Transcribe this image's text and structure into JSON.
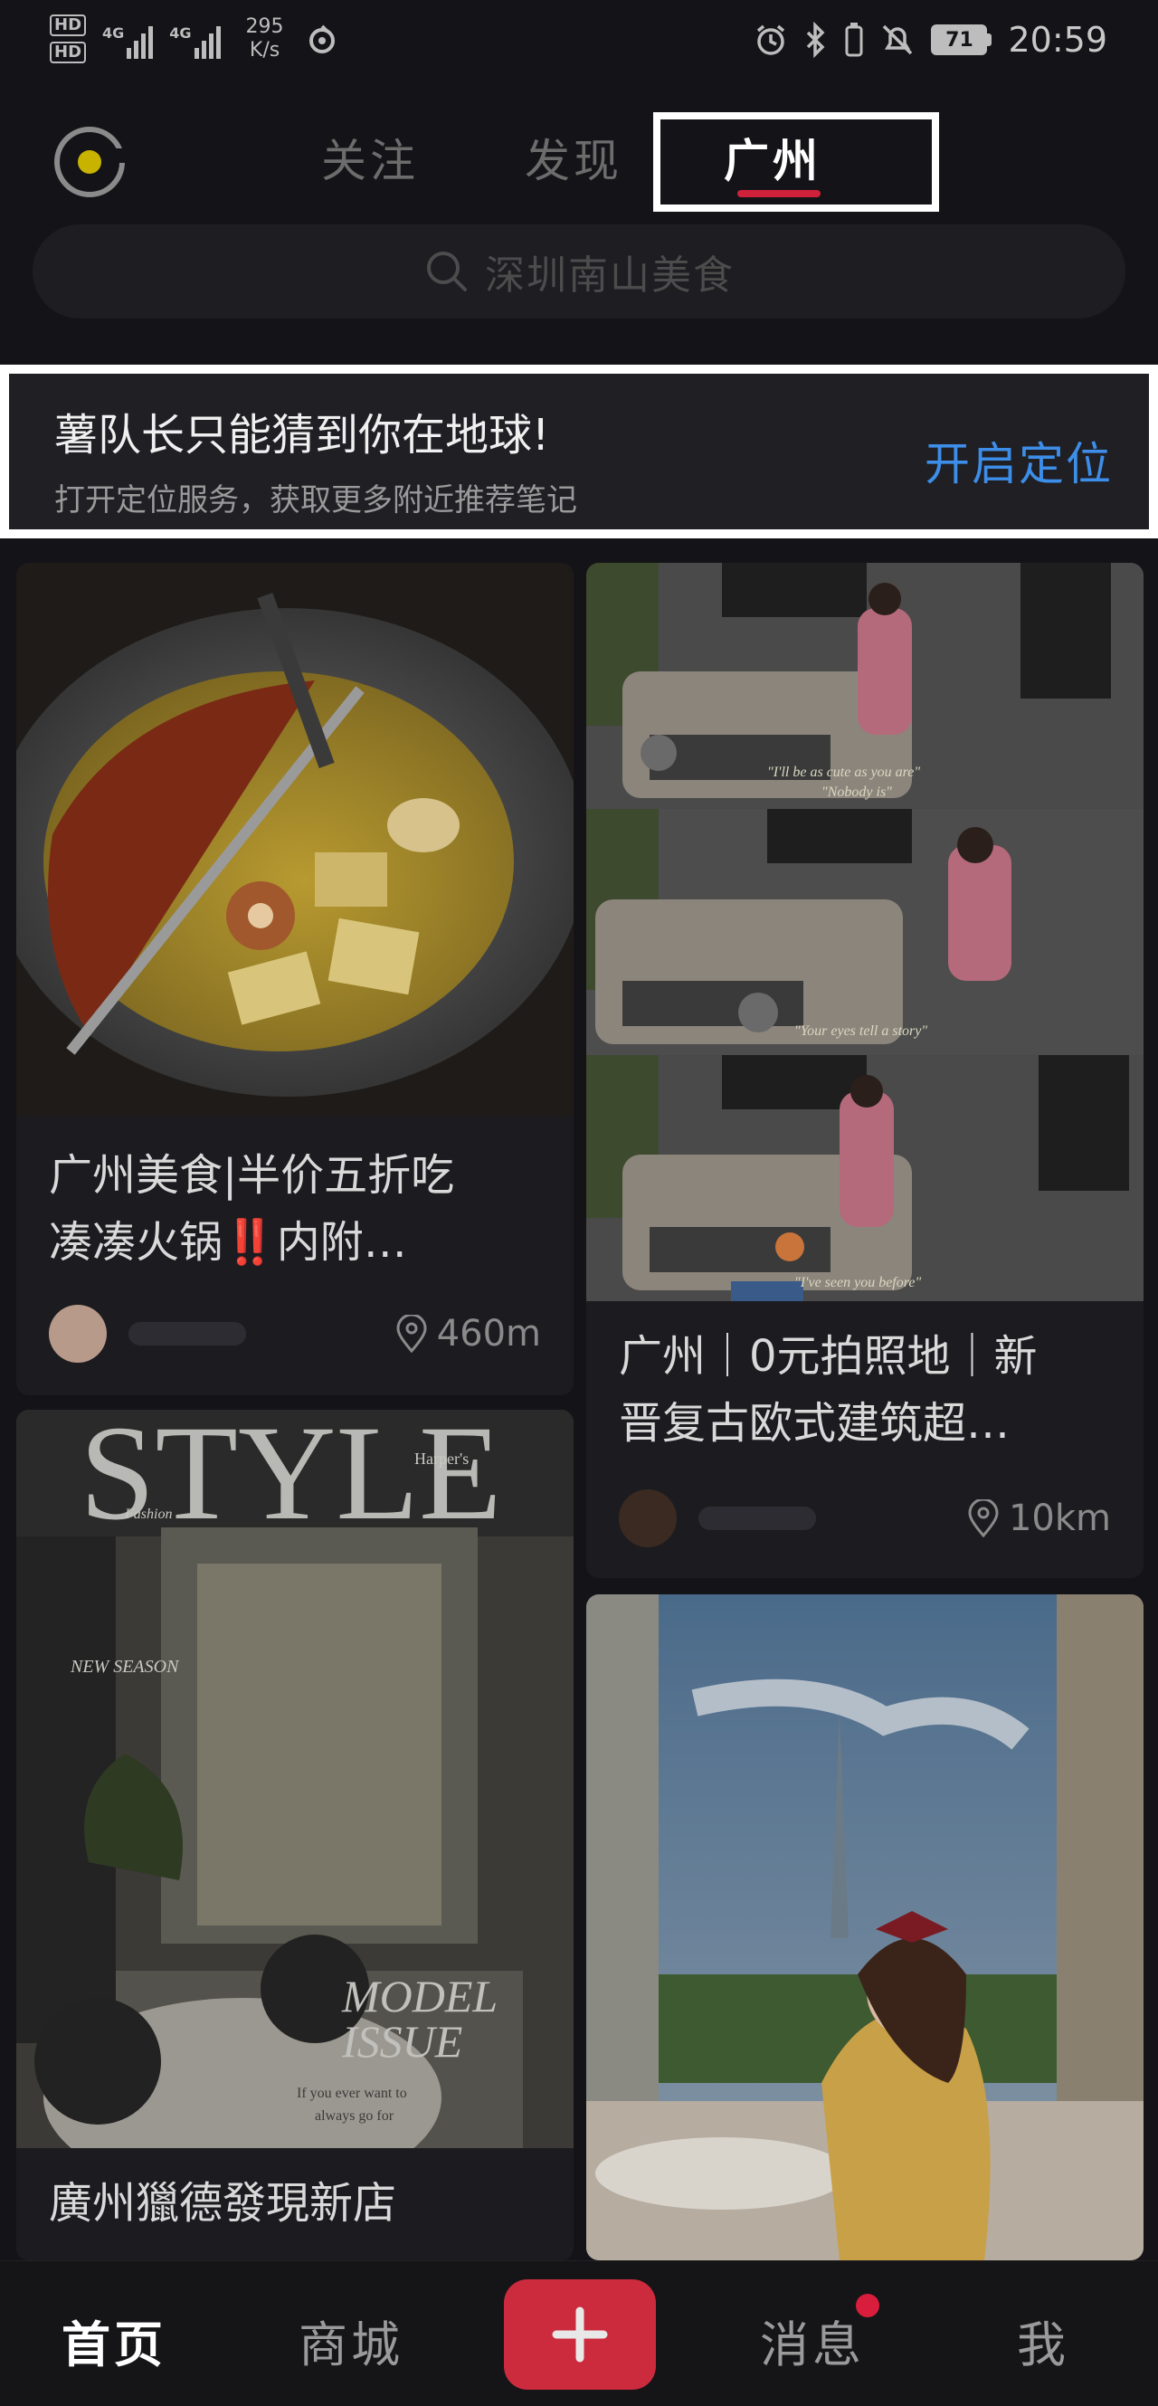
{
  "status_bar": {
    "hd_labels": [
      "HD",
      "HD"
    ],
    "network_label": "4G",
    "speed_value": "295",
    "speed_unit": "K/s",
    "battery": "71",
    "time": "20:59"
  },
  "header": {
    "tabs": [
      {
        "label": "关注",
        "active": false
      },
      {
        "label": "发现",
        "active": false
      },
      {
        "label": "广州",
        "active": true
      }
    ],
    "search_placeholder": "深圳南山美食"
  },
  "location_banner": {
    "title": "薯队长只能猜到你在地球!",
    "subtitle": "打开定位服务，获取更多附近推荐笔记",
    "button": "开启定位"
  },
  "feed": [
    {
      "title_line1": "广州美食|半价五折吃",
      "title_line2": "凑凑火锅‼️内附…",
      "distance": "460m"
    },
    {
      "title_line1": "广州｜0元拍照地｜新",
      "title_line2": "晋复古欧式建筑超…",
      "distance": "10km",
      "captions": [
        "\"I'll be as cute as you are\"",
        "\"Nobody is\"",
        "\"Your eyes tell a story\"",
        "\"I've seen you before\""
      ]
    },
    {
      "title_line1": "廣州獵德發現新店",
      "cover_text": [
        "STYLE",
        "Harper's",
        "Fashion",
        "NEW SEASON",
        "MODEL",
        "ISSUE",
        "If you ever want to",
        "always go for"
      ]
    },
    {
      "title_line1": ""
    }
  ],
  "bottom_nav": {
    "home": "首页",
    "mall": "商城",
    "messages": "消息",
    "me": "我"
  },
  "colors": {
    "accent_red": "#d0213b",
    "link_blue": "#3d8ee8",
    "background": "#141418"
  }
}
